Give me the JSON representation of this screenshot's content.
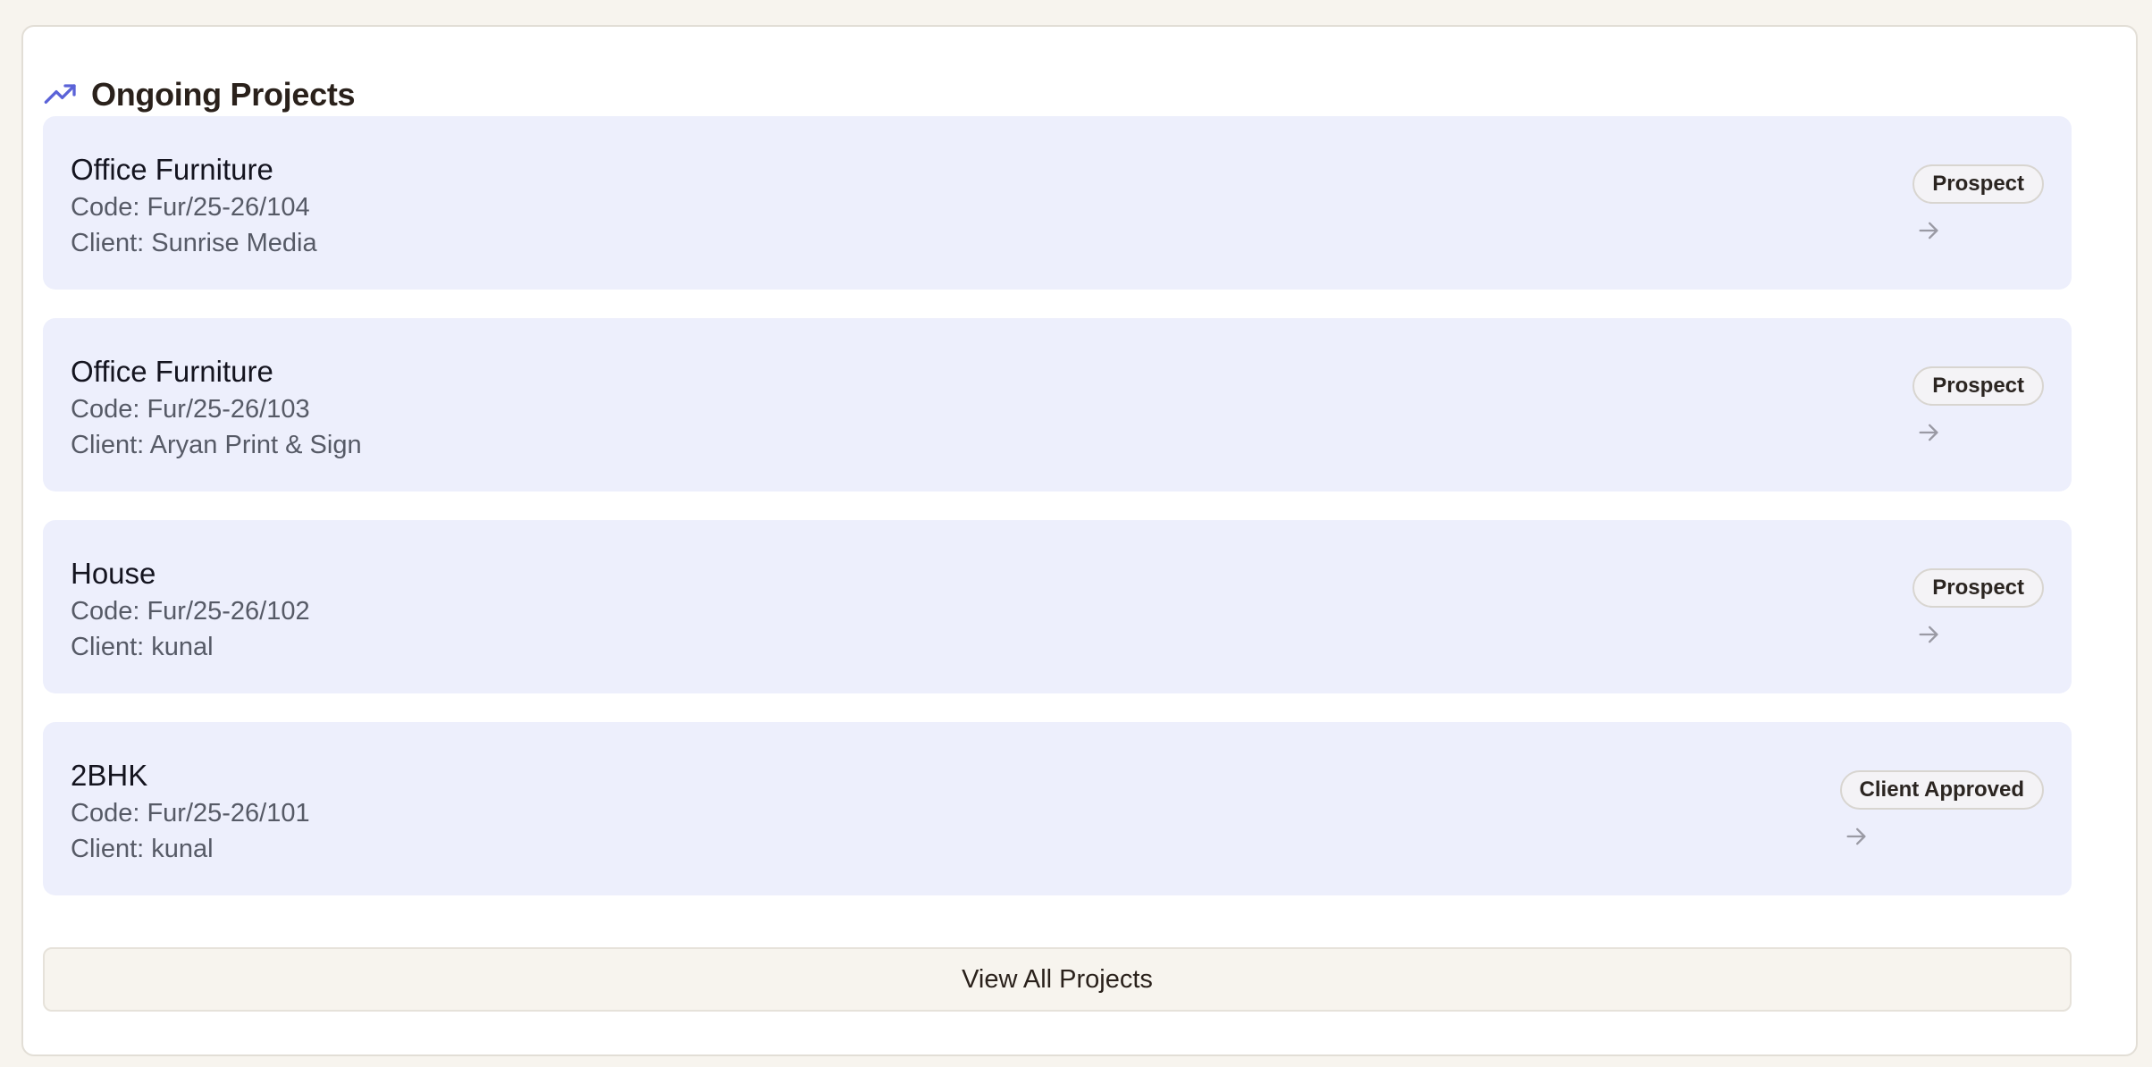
{
  "section": {
    "title": "Ongoing Projects",
    "icon": "trending-up-icon",
    "accent_color": "#5b63d8"
  },
  "projects": [
    {
      "name": "Office Furniture",
      "code": "Code: Fur/25-26/104",
      "client": "Client: Sunrise Media",
      "status": "Prospect"
    },
    {
      "name": "Office Furniture",
      "code": "Code: Fur/25-26/103",
      "client": "Client: Aryan Print & Sign",
      "status": "Prospect"
    },
    {
      "name": "House",
      "code": "Code: Fur/25-26/102",
      "client": "Client: kunal",
      "status": "Prospect"
    },
    {
      "name": "2BHK",
      "code": "Code: Fur/25-26/101",
      "client": "Client: kunal",
      "status": "Client Approved"
    }
  ],
  "view_all_label": "View All Projects"
}
